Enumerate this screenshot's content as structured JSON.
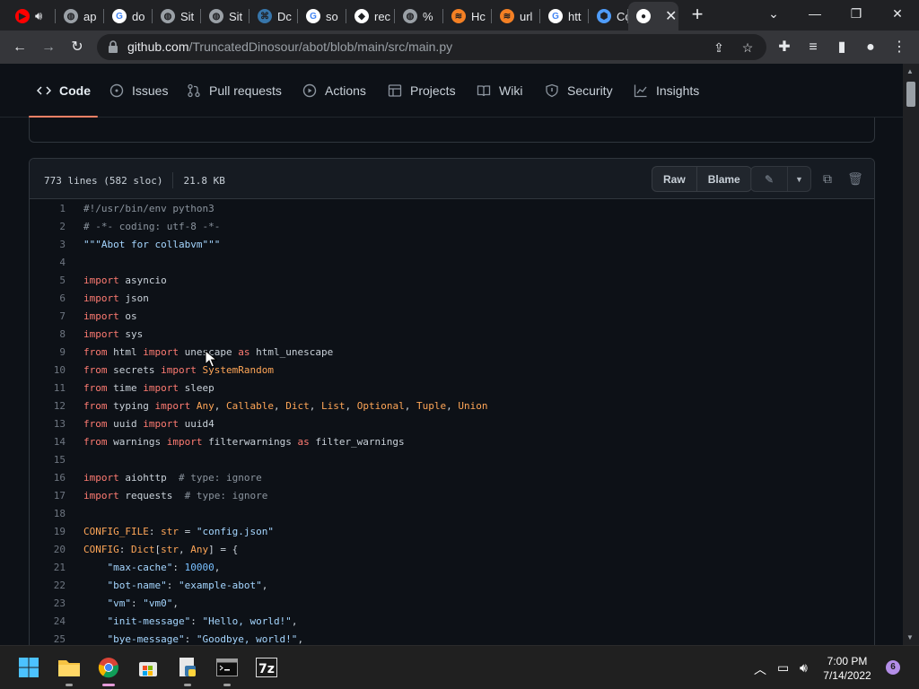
{
  "browser": {
    "tabs": [
      {
        "title": "",
        "favicon": "youtube-icon",
        "color": "#ff0000",
        "audio": true
      },
      {
        "title": "ap",
        "favicon": "globe-icon",
        "color": "#9aa0a6"
      },
      {
        "title": "do",
        "favicon": "google-icon",
        "color": "#ffffff"
      },
      {
        "title": "Sit",
        "favicon": "globe-icon",
        "color": "#9aa0a6"
      },
      {
        "title": "Sit",
        "favicon": "globe-icon",
        "color": "#9aa0a6"
      },
      {
        "title": "Dc",
        "favicon": "python-icon",
        "color": "#3776ab"
      },
      {
        "title": "so",
        "favicon": "google-icon",
        "color": "#ffffff"
      },
      {
        "title": "rec",
        "favicon": "cube-icon",
        "color": "#ffffff"
      },
      {
        "title": "%",
        "favicon": "globe-icon",
        "color": "#9aa0a6"
      },
      {
        "title": "Hc",
        "favicon": "stackoverflow-icon",
        "color": "#f48024"
      },
      {
        "title": "url",
        "favicon": "stackoverflow-icon",
        "color": "#f48024"
      },
      {
        "title": "htt",
        "favicon": "google-icon",
        "color": "#ffffff"
      },
      {
        "title": "Co",
        "favicon": "map-pin-icon",
        "color": "#4f9cf9"
      },
      {
        "title": "",
        "favicon": "github-icon",
        "color": "#ffffff",
        "active": true
      }
    ],
    "url": {
      "host": "github.com",
      "path": "/TruncatedDinosour/abot/blob/main/src/main.py"
    }
  },
  "repo_nav": {
    "items": [
      {
        "label": "Code",
        "icon": "code-icon",
        "selected": true
      },
      {
        "label": "Issues",
        "icon": "issue-circle-icon"
      },
      {
        "label": "Pull requests",
        "icon": "pull-request-icon"
      },
      {
        "label": "Actions",
        "icon": "play-circle-icon"
      },
      {
        "label": "Projects",
        "icon": "table-icon"
      },
      {
        "label": "Wiki",
        "icon": "book-icon"
      },
      {
        "label": "Security",
        "icon": "shield-icon"
      },
      {
        "label": "Insights",
        "icon": "graph-icon"
      }
    ]
  },
  "file": {
    "lines_info": "773 lines (582 sloc)",
    "size": "21.8 KB",
    "raw_label": "Raw",
    "blame_label": "Blame"
  },
  "code_lines": [
    "#!/usr/bin/env python3",
    "# -*- coding: utf-8 -*-",
    "\"\"\"Abot for collabvm\"\"\"",
    "",
    "import asyncio",
    "import json",
    "import os",
    "import sys",
    "from html import unescape as html_unescape",
    "from secrets import SystemRandom",
    "from time import sleep",
    "from typing import Any, Callable, Dict, List, Optional, Tuple, Union",
    "from uuid import uuid4",
    "from warnings import filterwarnings as filter_warnings",
    "",
    "import aiohttp  # type: ignore",
    "import requests  # type: ignore",
    "",
    "CONFIG_FILE: str = \"config.json\"",
    "CONFIG: Dict[str, Any] = {",
    "    \"max-cache\": 10000,",
    "    \"bot-name\": \"example-abot\",",
    "    \"vm\": \"vm0\",",
    "    \"init-message\": \"Hello, world!\",",
    "    \"bye-message\": \"Goodbye, world!\","
  ],
  "taskbar": {
    "apps": [
      "windows-start-icon",
      "file-explorer-icon",
      "chrome-icon",
      "store-icon",
      "python-editor-icon",
      "terminal-icon",
      "7zip-icon"
    ],
    "time": "7:00 PM",
    "date": "7/14/2022",
    "notifications": "6"
  }
}
